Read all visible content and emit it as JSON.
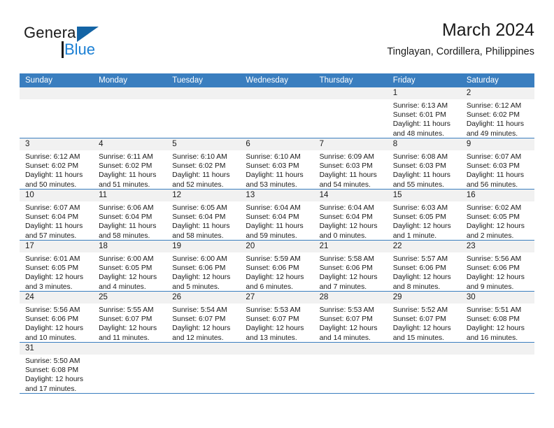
{
  "brand": {
    "name_primary": "General",
    "name_secondary": "Blue",
    "logo_icon": "triangle-flag-icon",
    "accent_color": "#1a7fd4"
  },
  "header": {
    "title": "March 2024",
    "subtitle": "Tinglayan, Cordillera, Philippines"
  },
  "calendar": {
    "header_bg": "#3a7ebf",
    "daynum_bg": "#f1f1f1",
    "weekdays": [
      "Sunday",
      "Monday",
      "Tuesday",
      "Wednesday",
      "Thursday",
      "Friday",
      "Saturday"
    ],
    "weeks": [
      [
        {
          "day": "",
          "empty": true,
          "sunrise": "",
          "sunset": "",
          "daylight1": "",
          "daylight2": ""
        },
        {
          "day": "",
          "empty": true,
          "sunrise": "",
          "sunset": "",
          "daylight1": "",
          "daylight2": ""
        },
        {
          "day": "",
          "empty": true,
          "sunrise": "",
          "sunset": "",
          "daylight1": "",
          "daylight2": ""
        },
        {
          "day": "",
          "empty": true,
          "sunrise": "",
          "sunset": "",
          "daylight1": "",
          "daylight2": ""
        },
        {
          "day": "",
          "empty": true,
          "sunrise": "",
          "sunset": "",
          "daylight1": "",
          "daylight2": ""
        },
        {
          "day": "1",
          "sunrise": "Sunrise: 6:13 AM",
          "sunset": "Sunset: 6:01 PM",
          "daylight1": "Daylight: 11 hours",
          "daylight2": "and 48 minutes."
        },
        {
          "day": "2",
          "sunrise": "Sunrise: 6:12 AM",
          "sunset": "Sunset: 6:02 PM",
          "daylight1": "Daylight: 11 hours",
          "daylight2": "and 49 minutes."
        }
      ],
      [
        {
          "day": "3",
          "sunrise": "Sunrise: 6:12 AM",
          "sunset": "Sunset: 6:02 PM",
          "daylight1": "Daylight: 11 hours",
          "daylight2": "and 50 minutes."
        },
        {
          "day": "4",
          "sunrise": "Sunrise: 6:11 AM",
          "sunset": "Sunset: 6:02 PM",
          "daylight1": "Daylight: 11 hours",
          "daylight2": "and 51 minutes."
        },
        {
          "day": "5",
          "sunrise": "Sunrise: 6:10 AM",
          "sunset": "Sunset: 6:02 PM",
          "daylight1": "Daylight: 11 hours",
          "daylight2": "and 52 minutes."
        },
        {
          "day": "6",
          "sunrise": "Sunrise: 6:10 AM",
          "sunset": "Sunset: 6:03 PM",
          "daylight1": "Daylight: 11 hours",
          "daylight2": "and 53 minutes."
        },
        {
          "day": "7",
          "sunrise": "Sunrise: 6:09 AM",
          "sunset": "Sunset: 6:03 PM",
          "daylight1": "Daylight: 11 hours",
          "daylight2": "and 54 minutes."
        },
        {
          "day": "8",
          "sunrise": "Sunrise: 6:08 AM",
          "sunset": "Sunset: 6:03 PM",
          "daylight1": "Daylight: 11 hours",
          "daylight2": "and 55 minutes."
        },
        {
          "day": "9",
          "sunrise": "Sunrise: 6:07 AM",
          "sunset": "Sunset: 6:03 PM",
          "daylight1": "Daylight: 11 hours",
          "daylight2": "and 56 minutes."
        }
      ],
      [
        {
          "day": "10",
          "sunrise": "Sunrise: 6:07 AM",
          "sunset": "Sunset: 6:04 PM",
          "daylight1": "Daylight: 11 hours",
          "daylight2": "and 57 minutes."
        },
        {
          "day": "11",
          "sunrise": "Sunrise: 6:06 AM",
          "sunset": "Sunset: 6:04 PM",
          "daylight1": "Daylight: 11 hours",
          "daylight2": "and 58 minutes."
        },
        {
          "day": "12",
          "sunrise": "Sunrise: 6:05 AM",
          "sunset": "Sunset: 6:04 PM",
          "daylight1": "Daylight: 11 hours",
          "daylight2": "and 58 minutes."
        },
        {
          "day": "13",
          "sunrise": "Sunrise: 6:04 AM",
          "sunset": "Sunset: 6:04 PM",
          "daylight1": "Daylight: 11 hours",
          "daylight2": "and 59 minutes."
        },
        {
          "day": "14",
          "sunrise": "Sunrise: 6:04 AM",
          "sunset": "Sunset: 6:04 PM",
          "daylight1": "Daylight: 12 hours",
          "daylight2": "and 0 minutes."
        },
        {
          "day": "15",
          "sunrise": "Sunrise: 6:03 AM",
          "sunset": "Sunset: 6:05 PM",
          "daylight1": "Daylight: 12 hours",
          "daylight2": "and 1 minute."
        },
        {
          "day": "16",
          "sunrise": "Sunrise: 6:02 AM",
          "sunset": "Sunset: 6:05 PM",
          "daylight1": "Daylight: 12 hours",
          "daylight2": "and 2 minutes."
        }
      ],
      [
        {
          "day": "17",
          "sunrise": "Sunrise: 6:01 AM",
          "sunset": "Sunset: 6:05 PM",
          "daylight1": "Daylight: 12 hours",
          "daylight2": "and 3 minutes."
        },
        {
          "day": "18",
          "sunrise": "Sunrise: 6:00 AM",
          "sunset": "Sunset: 6:05 PM",
          "daylight1": "Daylight: 12 hours",
          "daylight2": "and 4 minutes."
        },
        {
          "day": "19",
          "sunrise": "Sunrise: 6:00 AM",
          "sunset": "Sunset: 6:06 PM",
          "daylight1": "Daylight: 12 hours",
          "daylight2": "and 5 minutes."
        },
        {
          "day": "20",
          "sunrise": "Sunrise: 5:59 AM",
          "sunset": "Sunset: 6:06 PM",
          "daylight1": "Daylight: 12 hours",
          "daylight2": "and 6 minutes."
        },
        {
          "day": "21",
          "sunrise": "Sunrise: 5:58 AM",
          "sunset": "Sunset: 6:06 PM",
          "daylight1": "Daylight: 12 hours",
          "daylight2": "and 7 minutes."
        },
        {
          "day": "22",
          "sunrise": "Sunrise: 5:57 AM",
          "sunset": "Sunset: 6:06 PM",
          "daylight1": "Daylight: 12 hours",
          "daylight2": "and 8 minutes."
        },
        {
          "day": "23",
          "sunrise": "Sunrise: 5:56 AM",
          "sunset": "Sunset: 6:06 PM",
          "daylight1": "Daylight: 12 hours",
          "daylight2": "and 9 minutes."
        }
      ],
      [
        {
          "day": "24",
          "sunrise": "Sunrise: 5:56 AM",
          "sunset": "Sunset: 6:06 PM",
          "daylight1": "Daylight: 12 hours",
          "daylight2": "and 10 minutes."
        },
        {
          "day": "25",
          "sunrise": "Sunrise: 5:55 AM",
          "sunset": "Sunset: 6:07 PM",
          "daylight1": "Daylight: 12 hours",
          "daylight2": "and 11 minutes."
        },
        {
          "day": "26",
          "sunrise": "Sunrise: 5:54 AM",
          "sunset": "Sunset: 6:07 PM",
          "daylight1": "Daylight: 12 hours",
          "daylight2": "and 12 minutes."
        },
        {
          "day": "27",
          "sunrise": "Sunrise: 5:53 AM",
          "sunset": "Sunset: 6:07 PM",
          "daylight1": "Daylight: 12 hours",
          "daylight2": "and 13 minutes."
        },
        {
          "day": "28",
          "sunrise": "Sunrise: 5:53 AM",
          "sunset": "Sunset: 6:07 PM",
          "daylight1": "Daylight: 12 hours",
          "daylight2": "and 14 minutes."
        },
        {
          "day": "29",
          "sunrise": "Sunrise: 5:52 AM",
          "sunset": "Sunset: 6:07 PM",
          "daylight1": "Daylight: 12 hours",
          "daylight2": "and 15 minutes."
        },
        {
          "day": "30",
          "sunrise": "Sunrise: 5:51 AM",
          "sunset": "Sunset: 6:08 PM",
          "daylight1": "Daylight: 12 hours",
          "daylight2": "and 16 minutes."
        }
      ],
      [
        {
          "day": "31",
          "sunrise": "Sunrise: 5:50 AM",
          "sunset": "Sunset: 6:08 PM",
          "daylight1": "Daylight: 12 hours",
          "daylight2": "and 17 minutes."
        },
        {
          "day": "",
          "empty": true,
          "sunrise": "",
          "sunset": "",
          "daylight1": "",
          "daylight2": ""
        },
        {
          "day": "",
          "empty": true,
          "sunrise": "",
          "sunset": "",
          "daylight1": "",
          "daylight2": ""
        },
        {
          "day": "",
          "empty": true,
          "sunrise": "",
          "sunset": "",
          "daylight1": "",
          "daylight2": ""
        },
        {
          "day": "",
          "empty": true,
          "sunrise": "",
          "sunset": "",
          "daylight1": "",
          "daylight2": ""
        },
        {
          "day": "",
          "empty": true,
          "sunrise": "",
          "sunset": "",
          "daylight1": "",
          "daylight2": ""
        },
        {
          "day": "",
          "empty": true,
          "sunrise": "",
          "sunset": "",
          "daylight1": "",
          "daylight2": ""
        }
      ]
    ]
  }
}
